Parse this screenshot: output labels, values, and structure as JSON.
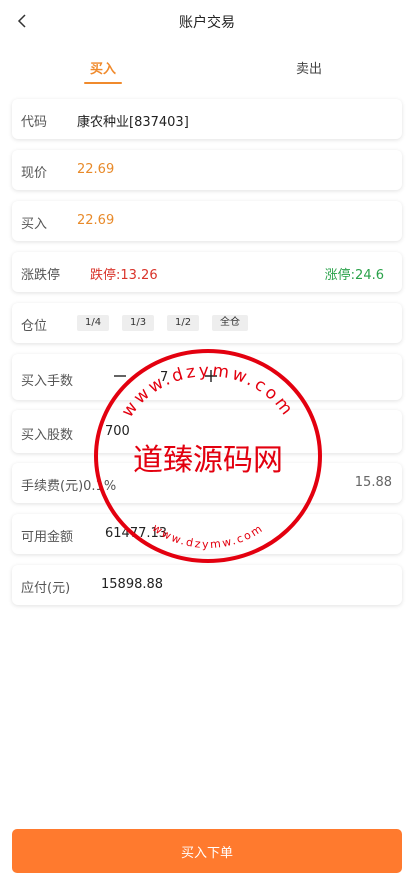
{
  "header": {
    "title": "账户交易"
  },
  "tabs": {
    "buy": "买入",
    "sell": "卖出"
  },
  "code": {
    "label": "代码",
    "value": "康农种业[837403]"
  },
  "current_price": {
    "label": "现价",
    "value": "22.69"
  },
  "buy_price": {
    "label": "买入",
    "value": "22.69"
  },
  "limits": {
    "label": "涨跌停",
    "limit_down": "跌停:13.26",
    "limit_up": "涨停:24.6"
  },
  "position": {
    "label": "仓位",
    "options": [
      "1/4",
      "1/3",
      "1/2",
      "全仓"
    ]
  },
  "lots": {
    "label": "买入手数",
    "value": "7"
  },
  "shares": {
    "label": "买入股数",
    "value": "700"
  },
  "fee": {
    "label": "手续费(元)0.1%",
    "value": "15.88"
  },
  "available": {
    "label": "可用金额",
    "value": "61477.13"
  },
  "payable": {
    "label": "应付(元)",
    "value": "15898.88"
  },
  "submit": {
    "label": "买入下单"
  },
  "watermark": {
    "center_text": "道臻源码网",
    "ring_text": "www.dzymw.com"
  },
  "colors": {
    "accent": "#ff7a2e",
    "tab_active": "#f08a2c",
    "price": "#e88a2a",
    "limit_down": "#d9332a",
    "limit_up": "#2aa24a",
    "stamp": "#e3000f"
  }
}
